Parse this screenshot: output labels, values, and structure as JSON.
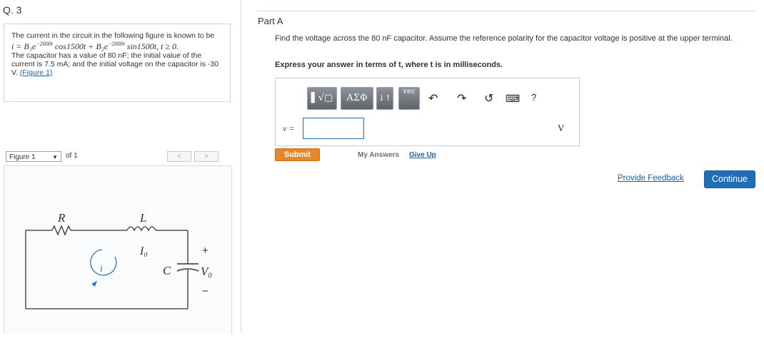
{
  "question_number": "Q. 3",
  "problem": {
    "line1": "The current in the circuit in the following figure is known to be",
    "equation": "i = B₁e",
    "exp1": "−2000t",
    "eq_mid": "cos1500t + B₂e",
    "exp2": "−2000t",
    "eq_end": "sin1500t, t ≥ 0.",
    "line2": "The capacitor has a value of 80 nF; the initial value of the current is 7.5 mA; and the initial voltage on the capacitor is -30 V.",
    "link": "(Figure 1)"
  },
  "figure_nav": {
    "select_value": "Figure 1",
    "of_text": "of 1",
    "prev": "<",
    "next": ">"
  },
  "circuit": {
    "R": "R",
    "L": "L",
    "I0": "I₀",
    "i": "i",
    "C": "C",
    "V0": "V₀",
    "plus": "+",
    "minus": "−"
  },
  "part": {
    "title": "Part A",
    "question": "Find the voltage across the 80 nF capacitor. Assume the reference polarity for the capacitor voltage is positive at the upper terminal.",
    "instruction": "Express your answer in terms of t, where t is in milliseconds."
  },
  "toolbar": {
    "templates": "▌√▢",
    "greek": "ΑΣΦ",
    "arrows": "↓↑",
    "vec": "vec",
    "undo": "↶",
    "redo": "↷",
    "reset": "↺",
    "keyboard": "⌨",
    "help": "?"
  },
  "answer": {
    "variable_label": "v =",
    "value": "",
    "unit": "V"
  },
  "buttons": {
    "submit": "Submit",
    "my_answers": "My Answers",
    "give_up": "Give Up",
    "feedback": "Provide Feedback",
    "continue": "Continue"
  }
}
